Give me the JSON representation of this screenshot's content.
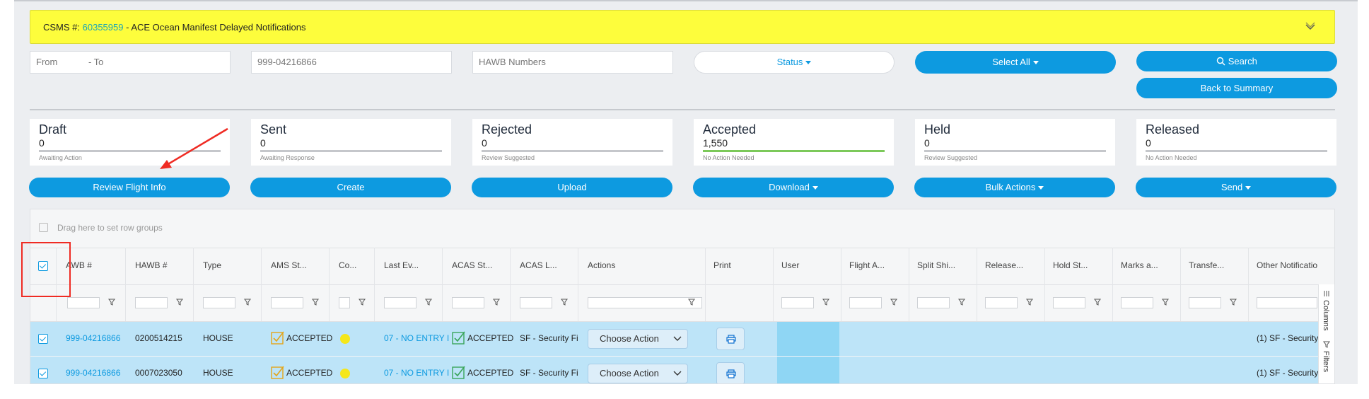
{
  "banner": {
    "prefix": "CSMS #:",
    "number": "60355959",
    "title": "- ACE Ocean Manifest Delayed Notifications"
  },
  "filters": {
    "date_from": "From",
    "date_to": "- To",
    "mawb_value": "999-04216866",
    "hawb_placeholder": "HAWB Numbers",
    "status_label": "Status",
    "select_all_label": "Select All",
    "search_label": "Search",
    "back_label": "Back to Summary"
  },
  "cards": [
    {
      "title": "Draft",
      "count": "0",
      "sub": "Awaiting Action"
    },
    {
      "title": "Sent",
      "count": "0",
      "sub": "Awaiting Response"
    },
    {
      "title": "Rejected",
      "count": "0",
      "sub": "Review Suggested"
    },
    {
      "title": "Accepted",
      "count": "1,550",
      "sub": "No Action Needed"
    },
    {
      "title": "Held",
      "count": "0",
      "sub": "Review Suggested"
    },
    {
      "title": "Released",
      "count": "0",
      "sub": "No Action Needed"
    }
  ],
  "actions": {
    "review": "Review Flight Info",
    "create": "Create",
    "upload": "Upload",
    "download": "Download",
    "bulk": "Bulk Actions",
    "send": "Send"
  },
  "grid": {
    "group_hint": "Drag here to set row groups",
    "columns": [
      "AWB #",
      "HAWB #",
      "Type",
      "AMS St...",
      "Co...",
      "Last Ev...",
      "ACAS St...",
      "ACAS L...",
      "Actions",
      "Print",
      "User",
      "Flight A...",
      "Split Shi...",
      "Release...",
      "Hold St...",
      "Marks a...",
      "Transfe...",
      "Other Notificatio"
    ],
    "side_columns": "Columns",
    "side_filters": "Filters",
    "rows": [
      {
        "awb": "999-04216866",
        "hawb": "0200514215",
        "type": "HOUSE",
        "ams": "ACCEPTED",
        "last_event": "07 - NO ENTRY I",
        "acas": "ACCEPTED",
        "acas_l": "SF - Security Fi",
        "action": "Choose Action",
        "other": "(1) SF - Security"
      },
      {
        "awb": "999-04216866",
        "hawb": "0007023050",
        "type": "HOUSE",
        "ams": "ACCEPTED",
        "last_event": "07 - NO ENTRY I",
        "acas": "ACCEPTED",
        "acas_l": "SF - Security Fi",
        "action": "Choose Action",
        "other": "(1) SF - Security"
      }
    ]
  },
  "colors": {
    "accent": "#0d9ae0",
    "banner": "#fdfd3c",
    "row_selected": "#bde4f8",
    "annotation": "#ef2b23"
  }
}
